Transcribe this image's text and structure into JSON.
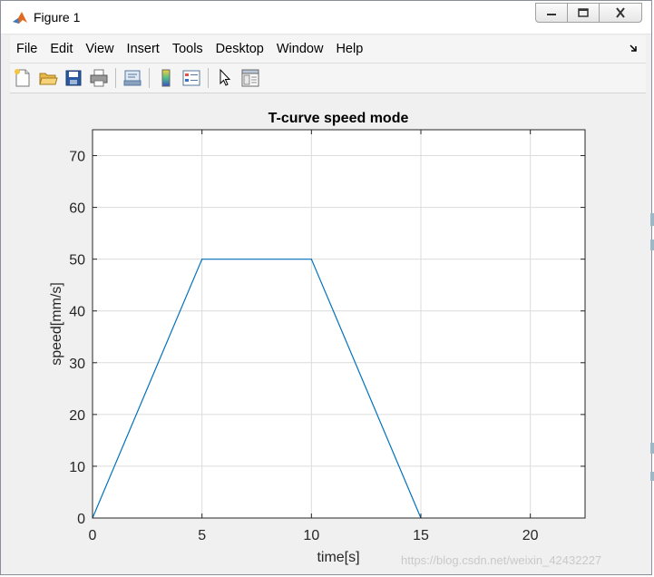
{
  "window": {
    "title": "Figure 1",
    "controls": [
      "minimize",
      "maximize",
      "close"
    ]
  },
  "menubar": {
    "items": [
      {
        "label": "File"
      },
      {
        "label": "Edit"
      },
      {
        "label": "View"
      },
      {
        "label": "Insert"
      },
      {
        "label": "Tools"
      },
      {
        "label": "Desktop"
      },
      {
        "label": "Window"
      },
      {
        "label": "Help"
      }
    ]
  },
  "toolbar": {
    "buttons": [
      {
        "icon": "new-figure-icon"
      },
      {
        "icon": "open-file-icon"
      },
      {
        "icon": "save-icon"
      },
      {
        "icon": "print-icon"
      },
      {
        "icon": "link-plot-icon"
      },
      {
        "icon": "insert-colorbar-icon"
      },
      {
        "icon": "insert-legend-icon"
      },
      {
        "icon": "edit-plot-icon"
      },
      {
        "icon": "property-inspector-icon"
      }
    ]
  },
  "watermark": "https://blog.csdn.net/weixin_42432227",
  "chart_data": {
    "type": "line",
    "title": "T-curve speed mode",
    "xlabel": "time[s]",
    "ylabel": "speed[mm/s]",
    "xlim": [
      0,
      22.5
    ],
    "ylim": [
      0,
      75
    ],
    "xticks": [
      0,
      5,
      10,
      15,
      20
    ],
    "yticks": [
      0,
      10,
      20,
      30,
      40,
      50,
      60,
      70
    ],
    "grid": true,
    "series": [
      {
        "color": "#0072bd",
        "x": [
          0,
          5,
          10,
          15
        ],
        "y": [
          0,
          50,
          50,
          0
        ]
      }
    ]
  }
}
